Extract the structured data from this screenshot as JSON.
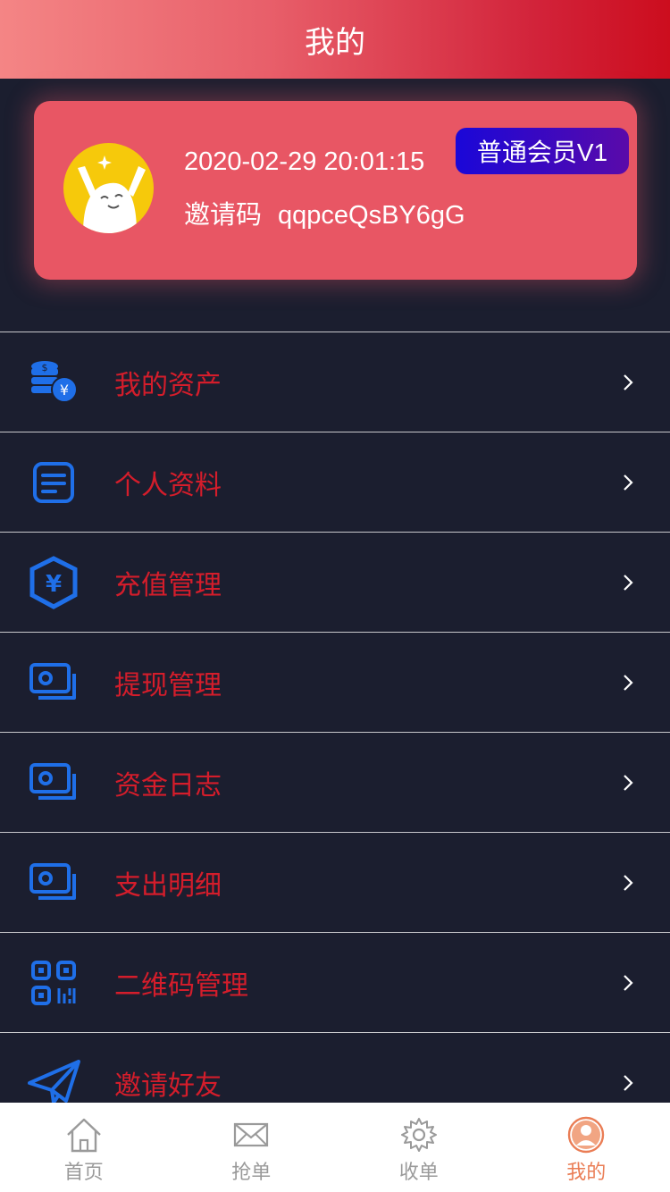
{
  "header": {
    "title": "我的"
  },
  "profile": {
    "datetime": "2020-02-29 20:01:15",
    "invite_label": "邀请码",
    "invite_code": "qqpceQsBY6gG",
    "member_badge": "普通会员V1"
  },
  "menu": [
    {
      "label": "我的资产",
      "icon": "coins-yen-icon"
    },
    {
      "label": "个人资料",
      "icon": "document-icon"
    },
    {
      "label": "充值管理",
      "icon": "shield-yen-icon"
    },
    {
      "label": "提现管理",
      "icon": "cash-icon"
    },
    {
      "label": "资金日志",
      "icon": "cash-icon"
    },
    {
      "label": "支出明细",
      "icon": "cash-icon"
    },
    {
      "label": "二维码管理",
      "icon": "qr-code-icon"
    },
    {
      "label": "邀请好友",
      "icon": "paper-plane-icon"
    }
  ],
  "tabbar": [
    {
      "label": "首页",
      "icon": "home-icon"
    },
    {
      "label": "抢单",
      "icon": "mail-icon"
    },
    {
      "label": "收单",
      "icon": "gear-icon"
    },
    {
      "label": "我的",
      "icon": "user-icon",
      "active": true
    }
  ],
  "colors": {
    "background": "#1b1e2f",
    "card": "#e85664",
    "menu_label": "#d41d2b",
    "icon_blue": "#1f6fe8",
    "tab_active": "#ea7d55"
  }
}
